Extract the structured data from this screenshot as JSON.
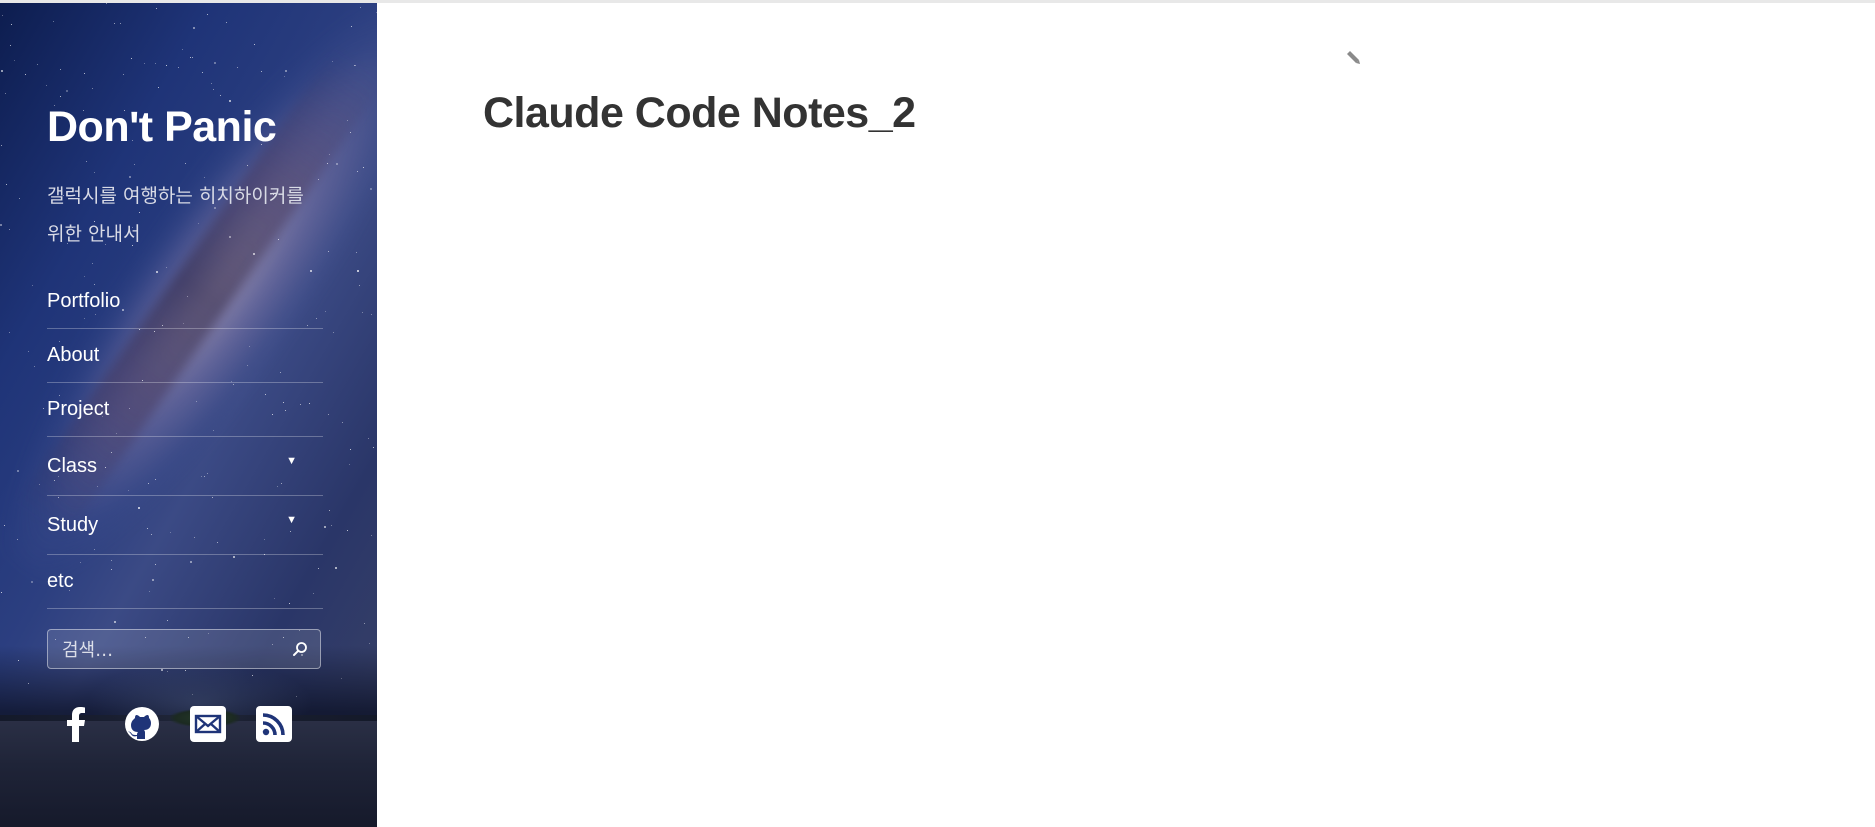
{
  "site": {
    "title": "Don't Panic",
    "description": "갤럭시를 여행하는 히치하이커를 위한 안내서"
  },
  "nav": {
    "items": [
      {
        "label": "Portfolio",
        "has_submenu": false
      },
      {
        "label": "About",
        "has_submenu": false
      },
      {
        "label": "Project",
        "has_submenu": false
      },
      {
        "label": "Class",
        "has_submenu": true
      },
      {
        "label": "Study",
        "has_submenu": true
      },
      {
        "label": "etc",
        "has_submenu": false
      }
    ]
  },
  "search": {
    "placeholder": "검색…",
    "value": ""
  },
  "social": [
    {
      "icon": "facebook-icon"
    },
    {
      "icon": "github-icon"
    },
    {
      "icon": "email-icon"
    },
    {
      "icon": "rss-icon"
    }
  ],
  "main": {
    "page_title": "Claude Code Notes_2",
    "edit_icon": "pencil-icon"
  },
  "colors": {
    "title_text": "#333333",
    "sidebar_text": "#ffffff",
    "sidebar_bg": "#1f3478"
  }
}
